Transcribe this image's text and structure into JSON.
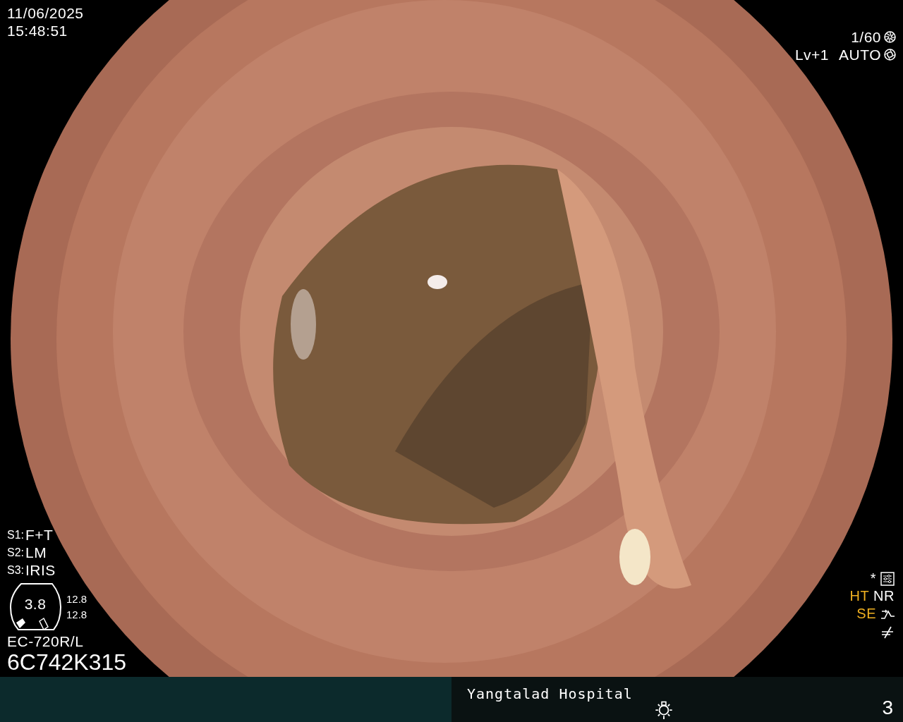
{
  "datetime": {
    "date": "11/06/2025",
    "time": "15:48:51"
  },
  "exposure": {
    "shutter": "1/60",
    "level": "Lv+1",
    "iris": "AUTO"
  },
  "switches": [
    {
      "label": "S1:",
      "value": "F+T"
    },
    {
      "label": "S2:",
      "value": "LM"
    },
    {
      "label": "S3:",
      "value": "IRIS"
    }
  ],
  "scope": {
    "gauge": "3.8",
    "readings": [
      "12.8",
      "12.8"
    ],
    "model": "EC-720R/L",
    "serial": "6C742K315"
  },
  "indicator_rows": [
    {
      "texts": [
        {
          "label": "*",
          "color": "#ffffff"
        }
      ]
    },
    {
      "texts": [
        {
          "label": "HT",
          "color": "#f0b020"
        },
        {
          "label": "NR",
          "color": "#ffffff"
        }
      ]
    },
    {
      "texts": [
        {
          "label": "SE",
          "color": "#f0b020"
        }
      ]
    }
  ],
  "footer": {
    "hospital": "Yangtalad Hospital",
    "page": "3"
  }
}
